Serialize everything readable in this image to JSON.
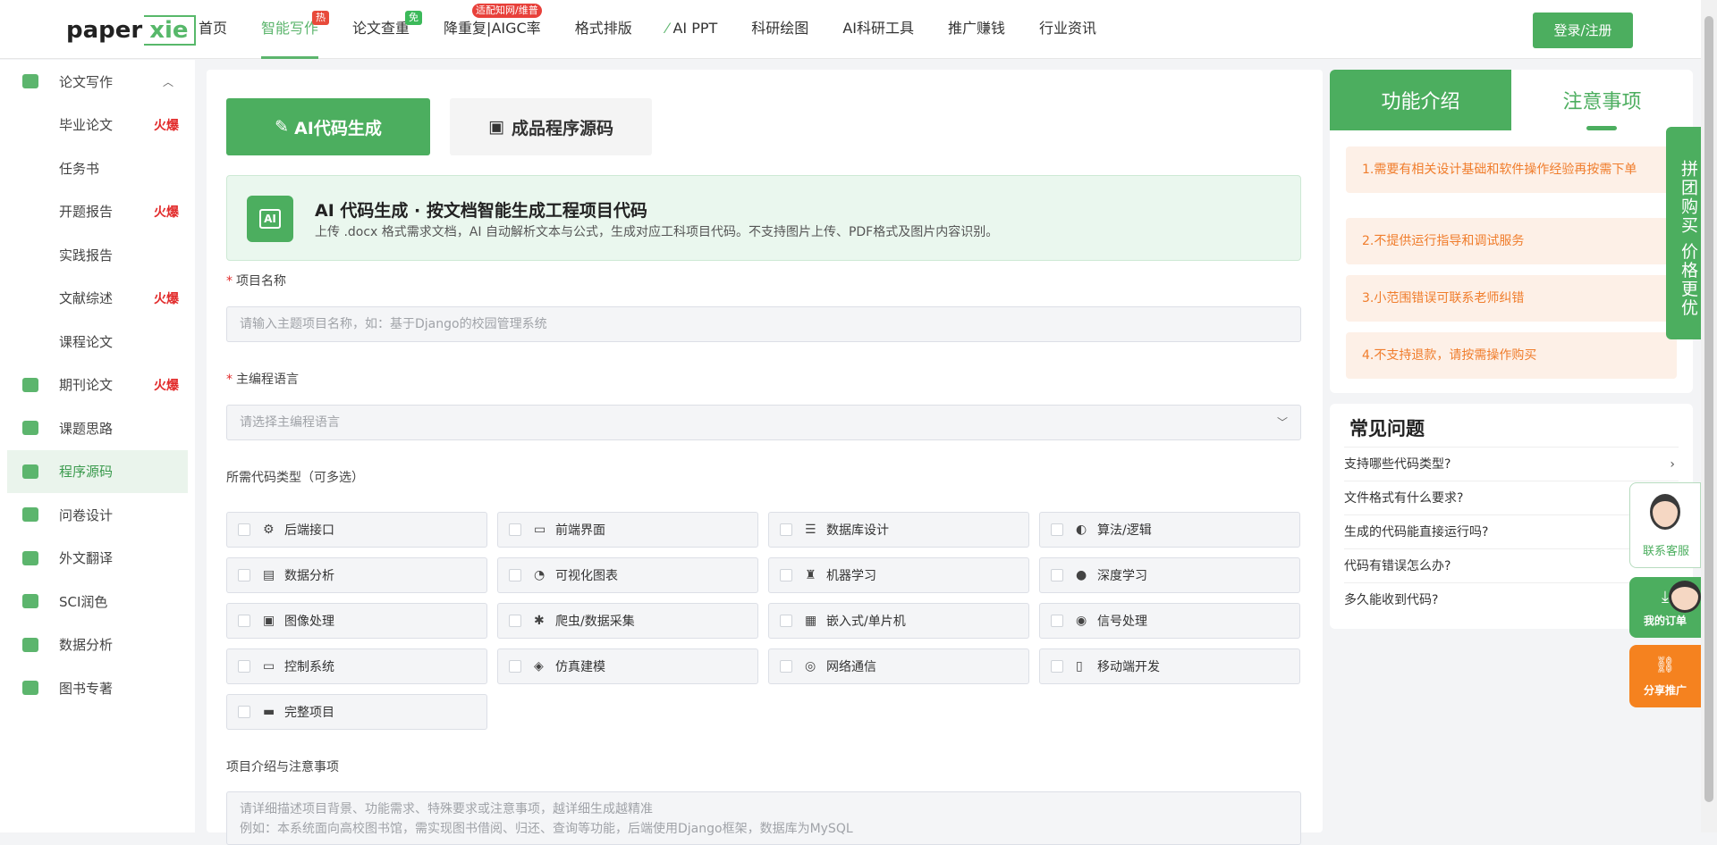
{
  "header": {
    "logo_text": "paperxie",
    "logo_left": "paper",
    "logo_right": "xie",
    "nav": [
      {
        "label": "首页",
        "badge": ""
      },
      {
        "label": "智能写作",
        "badge": "热"
      },
      {
        "label": "论文查重",
        "badge": "免"
      },
      {
        "label": "降重复|AIGC率",
        "badge": "适配知网/维普"
      },
      {
        "label": "格式排版",
        "badge": ""
      },
      {
        "label": "AI PPT",
        "badge": ""
      },
      {
        "label": "科研绘图",
        "badge": ""
      },
      {
        "label": "AI科研工具",
        "badge": ""
      },
      {
        "label": "推广赚钱",
        "badge": ""
      },
      {
        "label": "行业资讯",
        "badge": ""
      }
    ],
    "login_label": "登录/注册"
  },
  "sidebar": {
    "items": [
      {
        "label": "论文写作",
        "hot": "",
        "icon": "edit-icon"
      },
      {
        "label": "毕业论文",
        "hot": "火爆"
      },
      {
        "label": "任务书",
        "hot": ""
      },
      {
        "label": "开题报告",
        "hot": "火爆"
      },
      {
        "label": "实践报告",
        "hot": ""
      },
      {
        "label": "文献综述",
        "hot": "火爆"
      },
      {
        "label": "课程论文",
        "hot": ""
      },
      {
        "label": "期刊论文",
        "hot": "火爆",
        "icon": "journal-icon"
      },
      {
        "label": "课题思路",
        "hot": "",
        "icon": "idea-icon"
      },
      {
        "label": "程序源码",
        "hot": "",
        "icon": "code-icon"
      },
      {
        "label": "问卷设计",
        "hot": "",
        "icon": "survey-icon"
      },
      {
        "label": "外文翻译",
        "hot": "",
        "icon": "translate-icon"
      },
      {
        "label": "SCI润色",
        "hot": "",
        "icon": "sci-icon"
      },
      {
        "label": "数据分析",
        "hot": "",
        "icon": "chart-icon"
      },
      {
        "label": "图书专著",
        "hot": "",
        "icon": "book-icon"
      }
    ]
  },
  "main": {
    "tab_ai": "AI代码生成",
    "tab_source": "成品程序源码",
    "banner_icon": "AI",
    "banner_title": "AI 代码生成 · 按文档智能生成工程项目代码",
    "banner_desc": "上传 .docx 格式需求文档，AI 自动解析文本与公式，生成对应工科项目代码。不支持图片上传、PDF格式及图片内容识别。",
    "required_mark": "*",
    "project_name_label": "项目名称",
    "project_name_placeholder": "请输入主题项目名称，如：基于Django的校园管理系统",
    "lang_label": "主编程语言",
    "lang_placeholder": "请选择主编程语言",
    "types_label": "所需代码类型（可多选）",
    "types": [
      {
        "label": "后端接口",
        "icon": "⚙"
      },
      {
        "label": "前端界面",
        "icon": "▭"
      },
      {
        "label": "数据库设计",
        "icon": "☰"
      },
      {
        "label": "算法/逻辑",
        "icon": "◐"
      },
      {
        "label": "数据分析",
        "icon": "▤"
      },
      {
        "label": "可视化图表",
        "icon": "◔"
      },
      {
        "label": "机器学习",
        "icon": "♜"
      },
      {
        "label": "深度学习",
        "icon": "●"
      },
      {
        "label": "图像处理",
        "icon": "▣"
      },
      {
        "label": "爬虫/数据采集",
        "icon": "✱"
      },
      {
        "label": "嵌入式/单片机",
        "icon": "▦"
      },
      {
        "label": "信号处理",
        "icon": "◉"
      },
      {
        "label": "控制系统",
        "icon": "▭"
      },
      {
        "label": "仿真建模",
        "icon": "◈"
      },
      {
        "label": "网络通信",
        "icon": "◎"
      },
      {
        "label": "移动端开发",
        "icon": "▯"
      },
      {
        "label": "完整项目",
        "icon": "▬"
      }
    ],
    "desc_label": "项目介绍与注意事项",
    "desc_placeholder_1": "请详细描述项目背景、功能需求、特殊要求或注意事项，越详细生成越精准",
    "desc_placeholder_2": "例如：本系统面向高校图书馆，需实现图书借阅、归还、查询等功能，后端使用Django框架，数据库为MySQL"
  },
  "right": {
    "tab_intro": "功能介绍",
    "tab_notes": "注意事项",
    "notices": [
      "1.需要有相关设计基础和软件操作经验再按需下单",
      "2.不提供运行指导和调试服务",
      "3.小范围错误可联系老师纠错",
      "4.不支持退款，请按需操作购买"
    ],
    "faq_title": "常见问题",
    "faq": [
      "支持哪些代码类型?",
      "文件格式有什么要求?",
      "生成的代码能直接运行吗?",
      "代码有错误怎么办?",
      "多久能收到代码?"
    ]
  },
  "floating": {
    "group_buy": "拼团购买 价格更优",
    "customer_service": "联系客服",
    "my_orders": "我的订单",
    "share": "分享推广"
  },
  "colors": {
    "brand": "#4cae5f",
    "hot": "#e22b2b",
    "notice": "#f07d2c",
    "share": "#f5821f"
  }
}
